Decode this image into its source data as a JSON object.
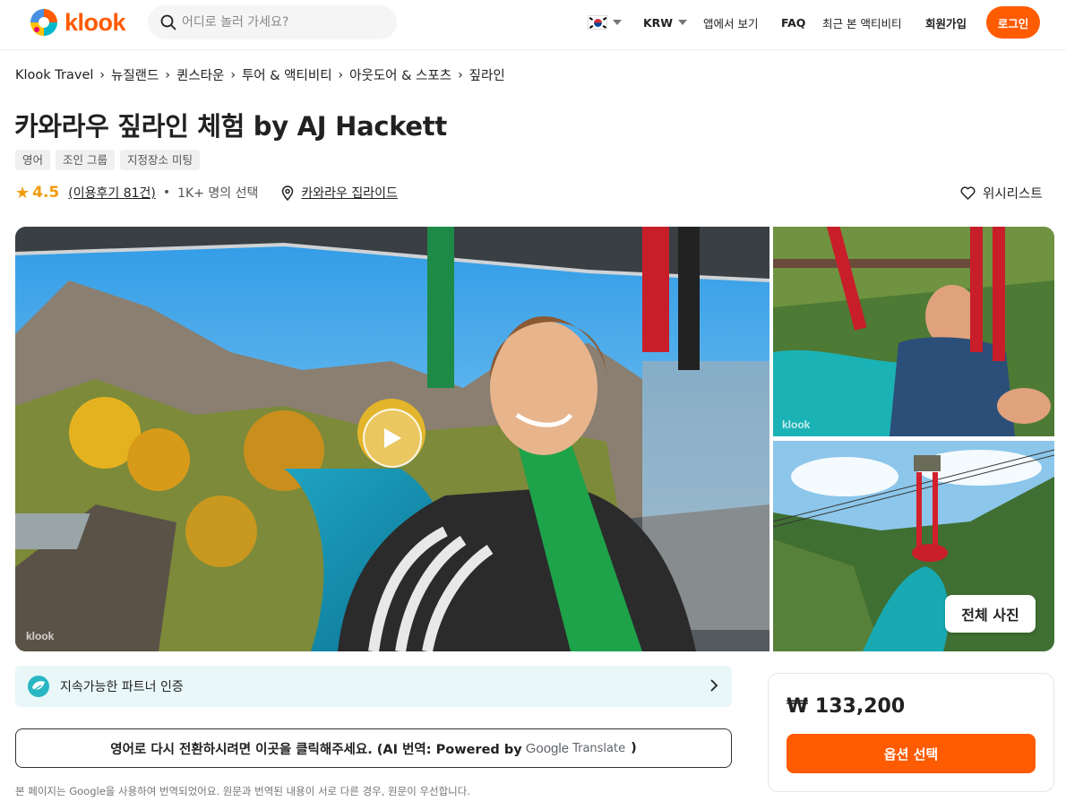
{
  "header": {
    "logo_text": "klook",
    "search_placeholder": "어디로 놀러 가세요?",
    "currency": "KRW",
    "app_link": "앱에서 보기",
    "faq": "FAQ",
    "recent": "최근 본 액티비티",
    "signup": "회원가입",
    "login": "로그인",
    "brand_color": "#ff5b00"
  },
  "breadcrumb": [
    "Klook Travel",
    "뉴질랜드",
    "퀸스타운",
    "투어 & 액티비티",
    "아웃도어 & 스포츠",
    "짚라인"
  ],
  "activity": {
    "title": "카와라우 짚라인 체험 by AJ Hackett",
    "tags": [
      "영어",
      "조인 그룹",
      "지정장소 미팅"
    ],
    "rating": "4.5",
    "reviews": "(이용후기 81건)",
    "booked": "1K+ 명의 선택",
    "location": "카와라우 집라이드",
    "wishlist": "위시리스트"
  },
  "gallery": {
    "watermark": "klook",
    "all_photos": "전체 사진",
    "play_icon": "play-icon"
  },
  "partner": {
    "label": "지속가능한 파트너 인증"
  },
  "translation": {
    "prompt": "영어로 다시 전환하시려면 이곳을 클릭해주세요. (AI 번역: Powered by",
    "google": "Google",
    "translate": "Translate",
    "close": ")",
    "notice": "본 페이지는 Google을 사용하여 번역되었어요. 원문과 번역된 내용이 서로 다른 경우, 원문이 우선합니다."
  },
  "booking": {
    "price": "₩ 133,200",
    "select_option": "옵션 선택"
  }
}
